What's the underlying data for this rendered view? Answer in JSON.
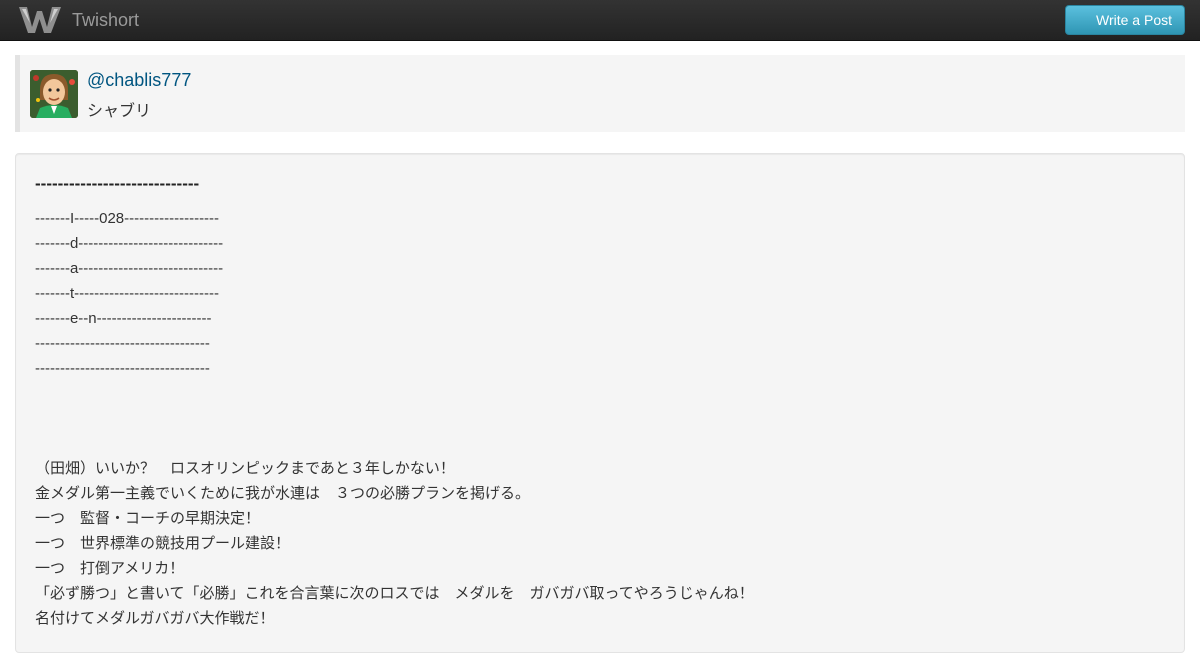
{
  "navbar": {
    "brand": "Twishort",
    "logo_icon": "twishort-logo-icon",
    "write_button": "Write a Post"
  },
  "profile": {
    "handle": "@chablis777",
    "display_name": "シャブリ",
    "avatar_icon": "user-avatar"
  },
  "post": {
    "title": "-----------------------------",
    "lines": [
      "-------I-----028-------------------",
      "-------d-----------------------------",
      "-------a-----------------------------",
      "-------t-----------------------------",
      "-------e--n-----------------------",
      "-----------------------------------",
      "-----------------------------------",
      "",
      "",
      "",
      "（田畑）いいか？　ロスオリンピックまであと３年しかない！",
      "金メダル第一主義でいくために我が水連は　３つの必勝プランを掲げる。",
      "一つ　監督・コーチの早期決定！",
      "一つ　世界標準の競技用プール建設！",
      "一つ　打倒アメリカ！",
      "「必ず勝つ」と書いて「必勝」これを合言葉に次のロスでは　メダルを　ガバガバ取ってやろうじゃんね！",
      "名付けてメダルガバガバ大作戦だ！"
    ]
  },
  "colors": {
    "navbar": "#222222",
    "brand_text": "#9a9a9a",
    "button": "#49afcd",
    "link": "#005580",
    "panel": "#f5f5f5"
  }
}
